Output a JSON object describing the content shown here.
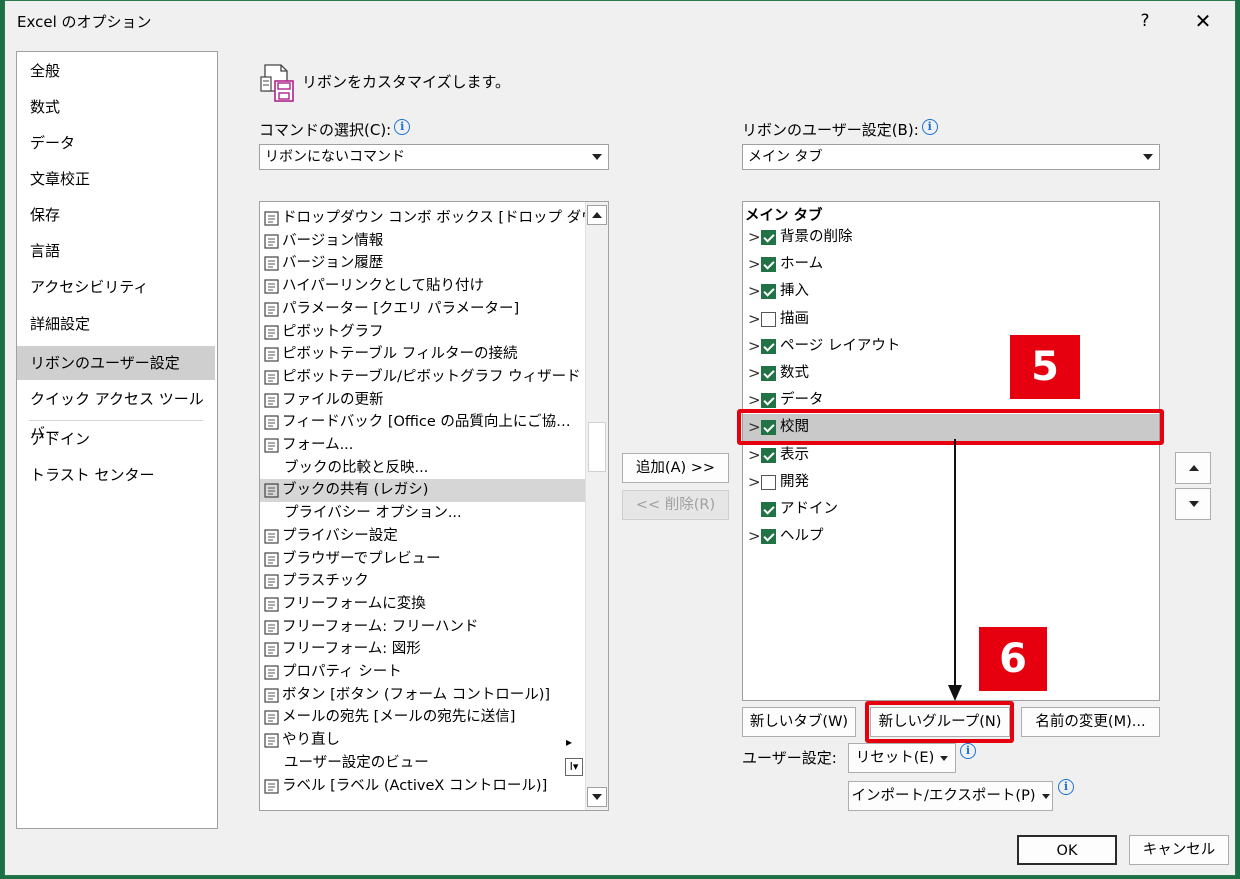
{
  "window": {
    "title": "Excel のオプション",
    "help": "?",
    "close": "✕"
  },
  "nav": {
    "items": [
      "全般",
      "数式",
      "データ",
      "文章校正",
      "保存",
      "言語",
      "アクセシビリティ",
      "詳細設定",
      "リボンのユーザー設定",
      "クイック アクセス ツール バー",
      "アドイン",
      "トラスト センター"
    ],
    "selected": "リボンのユーザー設定"
  },
  "header": {
    "text": "リボンをカスタマイズします。"
  },
  "commands": {
    "label": "コマンドの選択(C):",
    "combo_value": "リボンにないコマンド",
    "items": [
      {
        "label": "ドロップダウン コンボ ボックス [ドロップ ダウ…",
        "icon": "combo-icon"
      },
      {
        "label": "バージョン情報",
        "icon": "help-circle-icon"
      },
      {
        "label": "バージョン履歴",
        "icon": "history-icon"
      },
      {
        "label": "ハイパーリンクとして貼り付け",
        "icon": "paste-link-icon"
      },
      {
        "label": "パラメーター [クエリ パラメーター]",
        "icon": "parameter-icon"
      },
      {
        "label": "ピボットグラフ",
        "icon": "pivot-chart-icon"
      },
      {
        "label": "ピボットテーブル フィルターの接続",
        "icon": "pivot-filter-icon"
      },
      {
        "label": "ピボットテーブル/ピボットグラフ ウィザード",
        "icon": "pivot-wizard-icon"
      },
      {
        "label": "ファイルの更新",
        "icon": "refresh-file-icon"
      },
      {
        "label": "フィードバック [Office の品質向上にご協…",
        "icon": "feedback-icon"
      },
      {
        "label": "フォーム...",
        "icon": "form-icon"
      },
      {
        "label": "ブックの比較と反映...",
        "icon": ""
      },
      {
        "label": "ブックの共有 (レガシ)",
        "icon": "share-workbook-icon"
      },
      {
        "label": "プライバシー オプション...",
        "icon": ""
      },
      {
        "label": "プライバシー設定",
        "icon": "privacy-icon"
      },
      {
        "label": "ブラウザーでプレビュー",
        "icon": "browser-preview-icon"
      },
      {
        "label": "プラスチック",
        "icon": "plastic-icon"
      },
      {
        "label": "フリーフォームに変換",
        "icon": "freeform-convert-icon"
      },
      {
        "label": "フリーフォーム: フリーハンド",
        "icon": "freehand-icon"
      },
      {
        "label": "フリーフォーム: 図形",
        "icon": "freeform-shape-icon"
      },
      {
        "label": "プロパティ シート",
        "icon": "property-sheet-icon"
      },
      {
        "label": "ボタン [ボタン (フォーム コントロール)]",
        "icon": "button-control-icon"
      },
      {
        "label": "メールの宛先 [メールの宛先に送信]",
        "icon": "mail-icon"
      },
      {
        "label": "やり直し",
        "icon": "redo-icon"
      },
      {
        "label": "ユーザー設定のビュー",
        "icon": ""
      },
      {
        "label": "ラベル [ラベル (ActiveX コントロール)]",
        "icon": "label-a-icon"
      }
    ],
    "selected": "ブックの共有 (レガシ)"
  },
  "middle": {
    "add": "追加(A) >>",
    "remove": "<< 削除(R)"
  },
  "ribbon": {
    "label": "リボンのユーザー設定(B):",
    "combo_value": "メイン タブ",
    "tree_header": "メイン タブ",
    "tabs": [
      {
        "label": "背景の削除",
        "checked": true,
        "expander": true
      },
      {
        "label": "ホーム",
        "checked": true,
        "expander": true
      },
      {
        "label": "挿入",
        "checked": true,
        "expander": true
      },
      {
        "label": "描画",
        "checked": false,
        "expander": true
      },
      {
        "label": "ページ レイアウト",
        "checked": true,
        "expander": true
      },
      {
        "label": "数式",
        "checked": true,
        "expander": true
      },
      {
        "label": "データ",
        "checked": true,
        "expander": true
      },
      {
        "label": "校閲",
        "checked": true,
        "expander": true
      },
      {
        "label": "表示",
        "checked": true,
        "expander": true
      },
      {
        "label": "開発",
        "checked": false,
        "expander": true
      },
      {
        "label": "アドイン",
        "checked": true,
        "expander": false
      },
      {
        "label": "ヘルプ",
        "checked": true,
        "expander": true
      }
    ],
    "selected": "校閲"
  },
  "buttons": {
    "new_tab": "新しいタブ(W)",
    "new_group": "新しいグループ(N)",
    "rename": "名前の変更(M)...",
    "user_settings_label": "ユーザー設定:",
    "reset": "リセット(E)",
    "import_export": "インポート/エクスポート(P)",
    "ok": "OK",
    "cancel": "キャンセル"
  },
  "annotations": {
    "step5": "5",
    "step6": "6",
    "accent": "#e6000f"
  }
}
